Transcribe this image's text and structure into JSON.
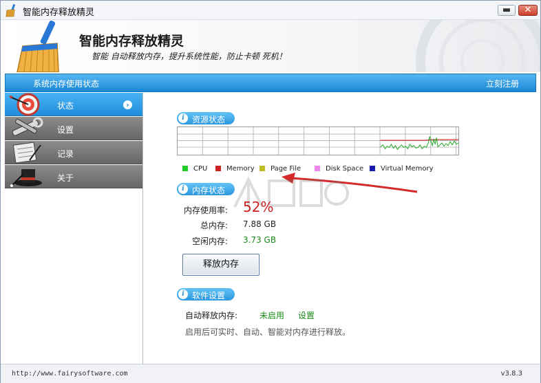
{
  "window": {
    "title": "智能内存释放精灵"
  },
  "header": {
    "app_name": "智能内存释放精灵",
    "slogan": "智能 自动释放内存，提升系统性能，防止卡顿 死机！"
  },
  "bluebar": {
    "status": "系统内存使用状态",
    "register": "立刻注册"
  },
  "sidebar": {
    "items": [
      {
        "label": "状态",
        "icon": "target-icon"
      },
      {
        "label": "设置",
        "icon": "tools-icon"
      },
      {
        "label": "记录",
        "icon": "notepad-icon"
      },
      {
        "label": "关于",
        "icon": "magician-hat-icon"
      }
    ]
  },
  "resource": {
    "title": "资源状态",
    "legend": [
      {
        "label": "CPU",
        "color": "#22cc22"
      },
      {
        "label": "Memory",
        "color": "#cc2222"
      },
      {
        "label": "Page File",
        "color": "#bbbb22"
      },
      {
        "label": "Disk Space",
        "color": "#ee88ee"
      },
      {
        "label": "Virtual Memory",
        "color": "#1a1aaa"
      }
    ]
  },
  "memory": {
    "title": "内存状态",
    "usage_label": "内存使用率:",
    "usage_value": "52%",
    "total_label": "总内存:",
    "total_value": "7.88 GB",
    "free_label": "空闲内存:",
    "free_value": "3.73 GB",
    "release_button": "释放内存"
  },
  "software": {
    "title": "软件设置",
    "auto_label": "自动释放内存:",
    "auto_status": "未启用",
    "settings_link": "设置",
    "hint": "启用后可实时、自动、智能对内存进行释放。"
  },
  "footer": {
    "url": "http://www.fairysoftware.com",
    "version": "v3.8.3"
  },
  "colors": {
    "accent_blue": "#1e8ddb",
    "usage_red": "#cc2020",
    "link_green": "#1a8a1a"
  }
}
